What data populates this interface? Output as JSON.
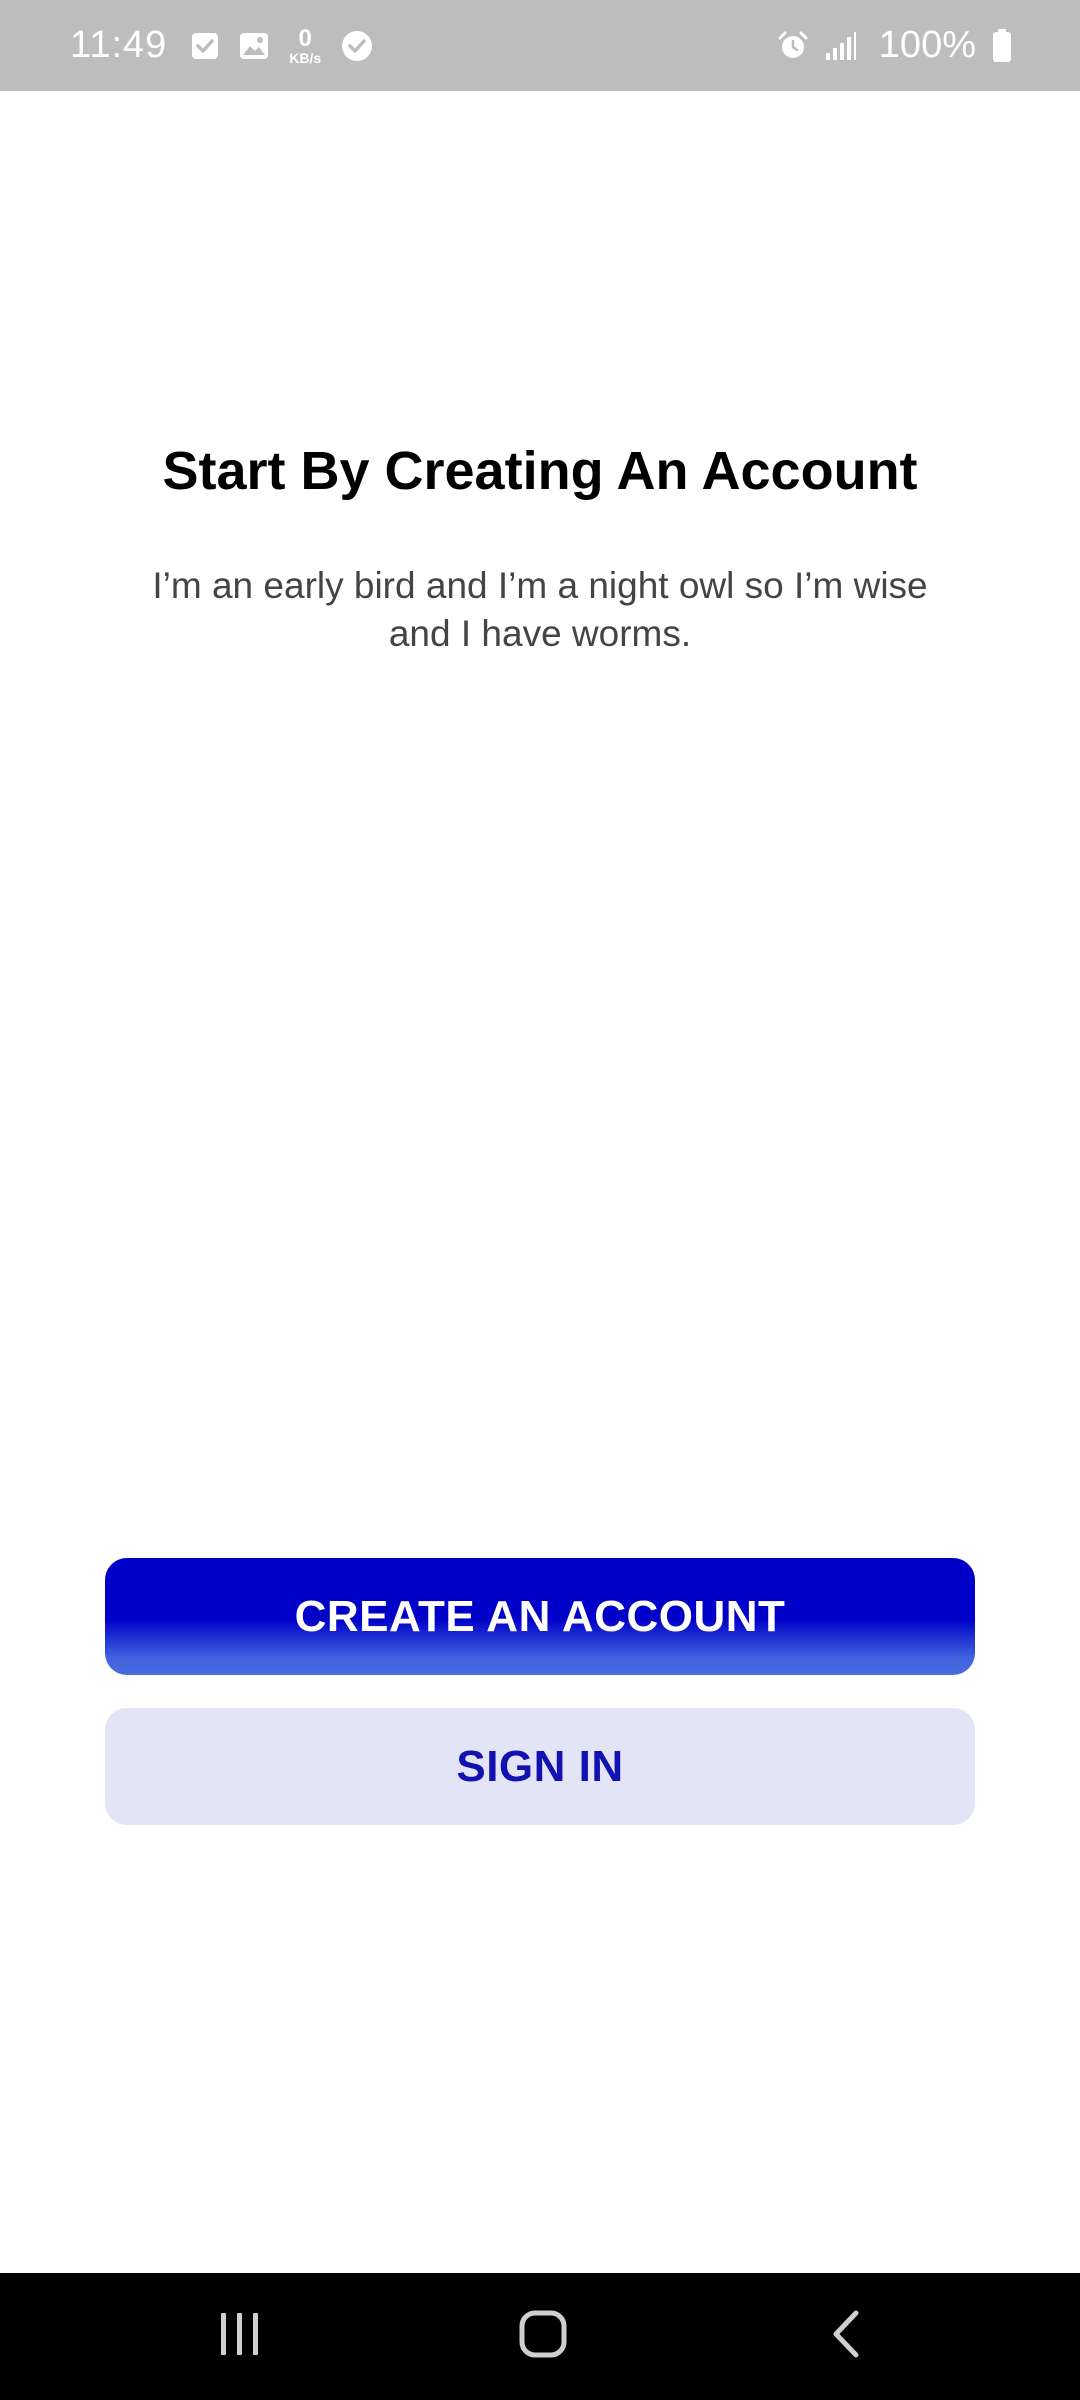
{
  "status_bar": {
    "time": "11:49",
    "net_speed_value": "0",
    "net_speed_unit": "KB/s",
    "battery": "100%",
    "left_icons": [
      "checkbox-icon",
      "image-icon",
      "network-speed-icon",
      "check-circle-icon"
    ],
    "right_icons": [
      "alarm-icon",
      "signal-icon",
      "battery-icon"
    ]
  },
  "main": {
    "title": "Start By Creating An Account",
    "subtitle_line1": "I’m an early bird and I’m a night owl so I’m wise",
    "subtitle_line2": "and I have worms."
  },
  "actions": {
    "create_label": "CREATE AN ACCOUNT",
    "signin_label": "SIGN IN"
  },
  "nav_bar": {
    "buttons": [
      "recents-icon",
      "home-icon",
      "back-icon"
    ]
  },
  "colors": {
    "status_bar_bg": "#bdbdbd",
    "primary": "#0000c8",
    "primary_gradient_end": "#4a6ce0",
    "secondary_bg": "#e4e4f7",
    "secondary_text": "#1212b0",
    "nav_bar_bg": "#000000"
  }
}
